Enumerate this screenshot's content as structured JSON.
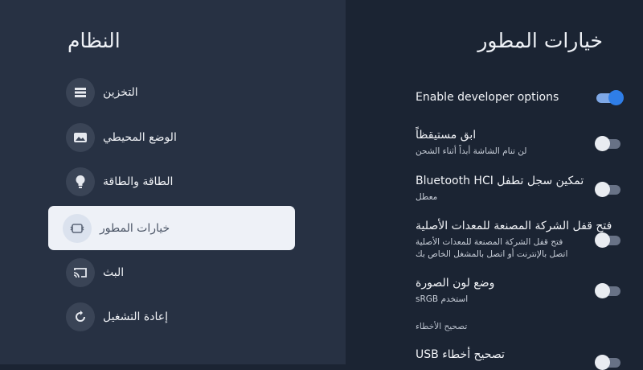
{
  "left_panel": {
    "title": "النظام",
    "items": [
      {
        "label": "التخزين",
        "icon": "storage-icon"
      },
      {
        "label": "الوضع المحيطي",
        "icon": "ambient-mode-icon"
      },
      {
        "label": "الطاقة والطاقة",
        "icon": "power-bulb-icon"
      },
      {
        "label": "خيارات المطور",
        "icon": "developer-options-icon",
        "selected": true
      },
      {
        "label": "البث",
        "icon": "cast-icon"
      },
      {
        "label": "إعادة التشغيل",
        "icon": "restart-icon"
      }
    ]
  },
  "right_panel": {
    "title": "خيارات المطور",
    "settings": [
      {
        "title": "Enable developer options",
        "subtitle": "",
        "enabled": true
      },
      {
        "title": "ابق مستيقظاً",
        "subtitle": "لن تنام الشاشة أبداً أثناء الشحن",
        "enabled": false
      },
      {
        "title": "تمكين سجل تطفل Bluetooth HCI",
        "subtitle": "معطل",
        "enabled": false
      },
      {
        "title": "فتح قفل الشركة المصنعة للمعدات الأصلية",
        "subtitle": "فتح قفل الشركة المصنعة للمعدات الأصلية\nاتصل بالإنترنت أو اتصل بالمشغل الخاص بك",
        "enabled": false
      },
      {
        "title": "وضع لون الصورة",
        "subtitle": "استخدم sRGB",
        "enabled": false
      }
    ],
    "section_header": "تصحيح الأخطاء",
    "usb_debugging": {
      "title": "تصحيح أخطاء USB",
      "enabled": false
    }
  },
  "colors": {
    "accent": "#2f7ee8",
    "background": "#1b2433",
    "left_panel": "#273143"
  }
}
